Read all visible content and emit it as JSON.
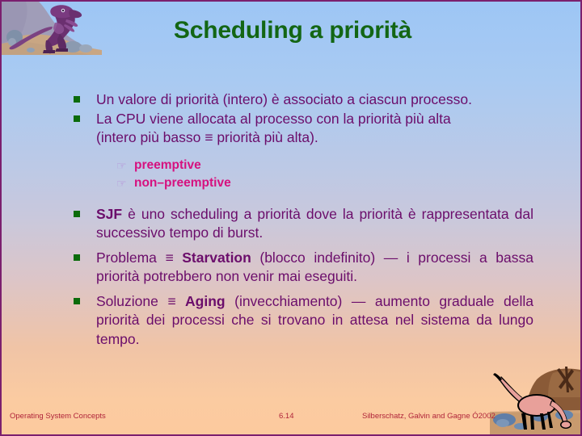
{
  "slide": {
    "title": "Scheduling a priorità",
    "accent_title_color": "#136614",
    "body_text_color": "#6b0d6b",
    "sub_bullet_color": "#d6117f",
    "bullet_square_color": "#0b6b0b",
    "border_color": "#7b1f6e",
    "background_top_color": "#9dc6f5",
    "background_bottom_color": "#fcca9e"
  },
  "bullets": {
    "b1": "Un  valore di priorità (intero) è associato a ciascun processo.",
    "b2_line1": "La   CPU   viene  allocata  al processo con la priorità più alta",
    "b2_line2": "(intero più basso ≡  priorità più alta).",
    "sub1": "preemptive",
    "sub2": "non–preemptive",
    "b3_strong": "SJF",
    "b3_rest": "è  uno   scheduling  a  priorità  dove  la  priorità  è rappresentata dal successivo tempo di burst.",
    "b4_pre": "Problema ≡ ",
    "b4_strong": "Starvation",
    "b4_rest": " (blocco indefinito)  —  i  processi a bassa priorità potrebbero non venir mai eseguiti.",
    "b5_pre": "Soluzione ≡ ",
    "b5_strong": "Aging",
    "b5_rest": " (invecchiamento) — aumento  graduale della  priorità  dei  processi  che  si  trovano in attesa  nel sistema da lungo tempo."
  },
  "icons": {
    "square_bullet": "■",
    "hand_bullet": "☞"
  },
  "footer": {
    "left": "Operating System Concepts",
    "center": "6.14",
    "right": "Silberschatz, Galvin and  Gagne Ó2002"
  },
  "artwork": {
    "top_left": "purple-tyrannosaurus-on-rocky-hill",
    "bottom_right": "pink-sauropod-dinosaur-with-rock"
  }
}
